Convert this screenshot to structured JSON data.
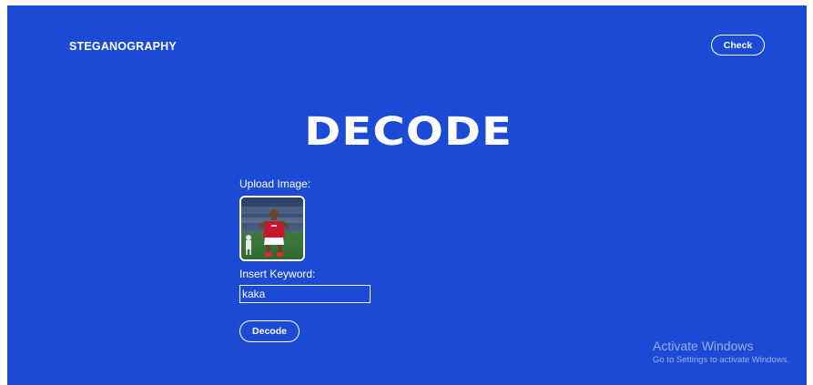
{
  "header": {
    "brand": "STEGANOGRAPHY",
    "check_label": "Check"
  },
  "main": {
    "title": "DECODE",
    "upload_label": "Upload Image:",
    "keyword_label": "Insert Keyword:",
    "keyword_value": "kaka",
    "decode_label": "Decode"
  },
  "watermark": {
    "title": "Activate Windows",
    "subtitle": "Go to Settings to activate Windows."
  },
  "colors": {
    "background": "#1b4ad5",
    "text": "#ffffff"
  }
}
